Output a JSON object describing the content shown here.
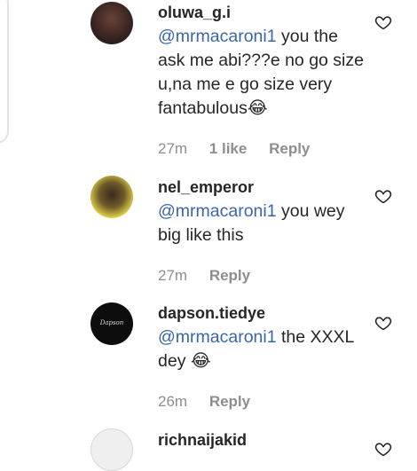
{
  "comments": [
    {
      "username": "oluwa_g.i",
      "mention": "@mrmacaroni1",
      "text": " you the ask me abi???e no go size u,na me e go size very fantabulous",
      "emoji": "😂",
      "time": "27m",
      "likes": "1 like",
      "reply": "Reply"
    },
    {
      "username": "nel_emperor",
      "mention": "@mrmacaroni1",
      "text": " you wey big like this",
      "emoji": "",
      "time": "27m",
      "likes": "",
      "reply": "Reply"
    },
    {
      "username": "dapson.tiedye",
      "mention": "@mrmacaroni1",
      "text": " the XXXL dey ",
      "emoji": "😂",
      "time": "26m",
      "likes": "",
      "reply": "Reply",
      "avatar_logo_text": "Dapson"
    },
    {
      "username": "richnaijakid",
      "mention": "",
      "text": "",
      "emoji": "",
      "time": "",
      "likes": "",
      "reply": ""
    }
  ],
  "colors": {
    "mention": "#3a66a8",
    "meta": "#8e8e8e",
    "text": "#262626"
  },
  "icons": {
    "like": "heart-outline-icon"
  }
}
